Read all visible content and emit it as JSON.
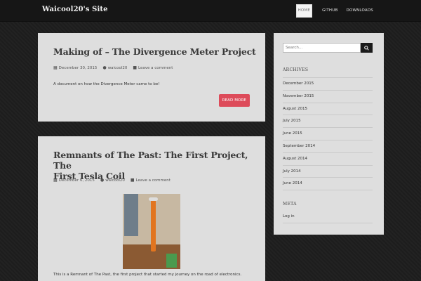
{
  "site": {
    "title": "Waicool20's Site"
  },
  "nav": {
    "items": [
      "HOME",
      "GITHUB",
      "DOWNLOADS"
    ]
  },
  "posts": [
    {
      "title": "Making of – The Divergence Meter Project",
      "date": "December 30, 2015",
      "author": "waicool20",
      "comments": "Leave a comment",
      "excerpt": "A document on how the Divergence Meter came to be!",
      "read_more": "READ MORE"
    },
    {
      "title_line1": "Remnants of The Past: The First Project, The",
      "title_line2": "First Tesla Coil",
      "date": "December 6, 2015",
      "author": "waicool20",
      "comments": "Leave a comment",
      "excerpt": "This is a Remnant of The Past, the first project that started my journey on the road of electronics."
    }
  ],
  "sidebar": {
    "search": {
      "placeholder": "Search..."
    },
    "archives": {
      "title": "ARCHIVES",
      "items": [
        "December 2015",
        "November 2015",
        "August 2015",
        "July 2015",
        "June 2015",
        "September 2014",
        "August 2014",
        "July 2014",
        "June 2014"
      ]
    },
    "meta": {
      "title": "META",
      "items": [
        "Log in"
      ]
    }
  },
  "colors": {
    "accent": "#dd4b5a",
    "navbar": "#161616",
    "card": "#dedede"
  },
  "icons": [
    "calendar-icon",
    "user-icon",
    "comment-icon",
    "search-icon"
  ]
}
